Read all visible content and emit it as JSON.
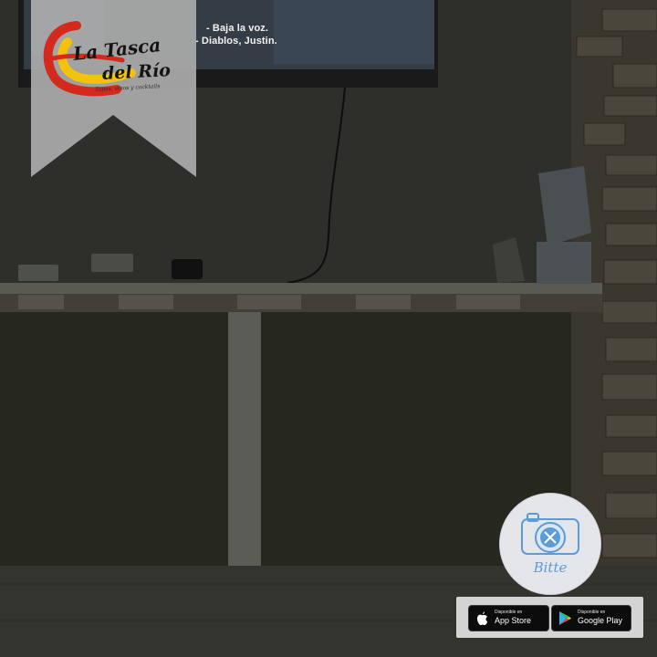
{
  "tv": {
    "subtitle_line1": "- Baja la voz.",
    "subtitle_line2": "- Diablos, Justin."
  },
  "logo": {
    "line1": "La Tasca",
    "line2": "del Río",
    "tagline": "Tapas, vinos y cocktails"
  },
  "bitte": {
    "label": "Bitte",
    "icon": "camera-with-cutlery-icon"
  },
  "app_store": {
    "small": "Disponible en",
    "label": "App Store",
    "icon": "apple-icon"
  },
  "google_play": {
    "small": "Disponible en",
    "label": "Google Play",
    "icon": "google-play-icon"
  },
  "colors": {
    "ribbon": "#a8a8a8",
    "bitte_blue": "#5b9bd6",
    "flag_red": "#d42a1e",
    "flag_yellow": "#f2c20c"
  }
}
